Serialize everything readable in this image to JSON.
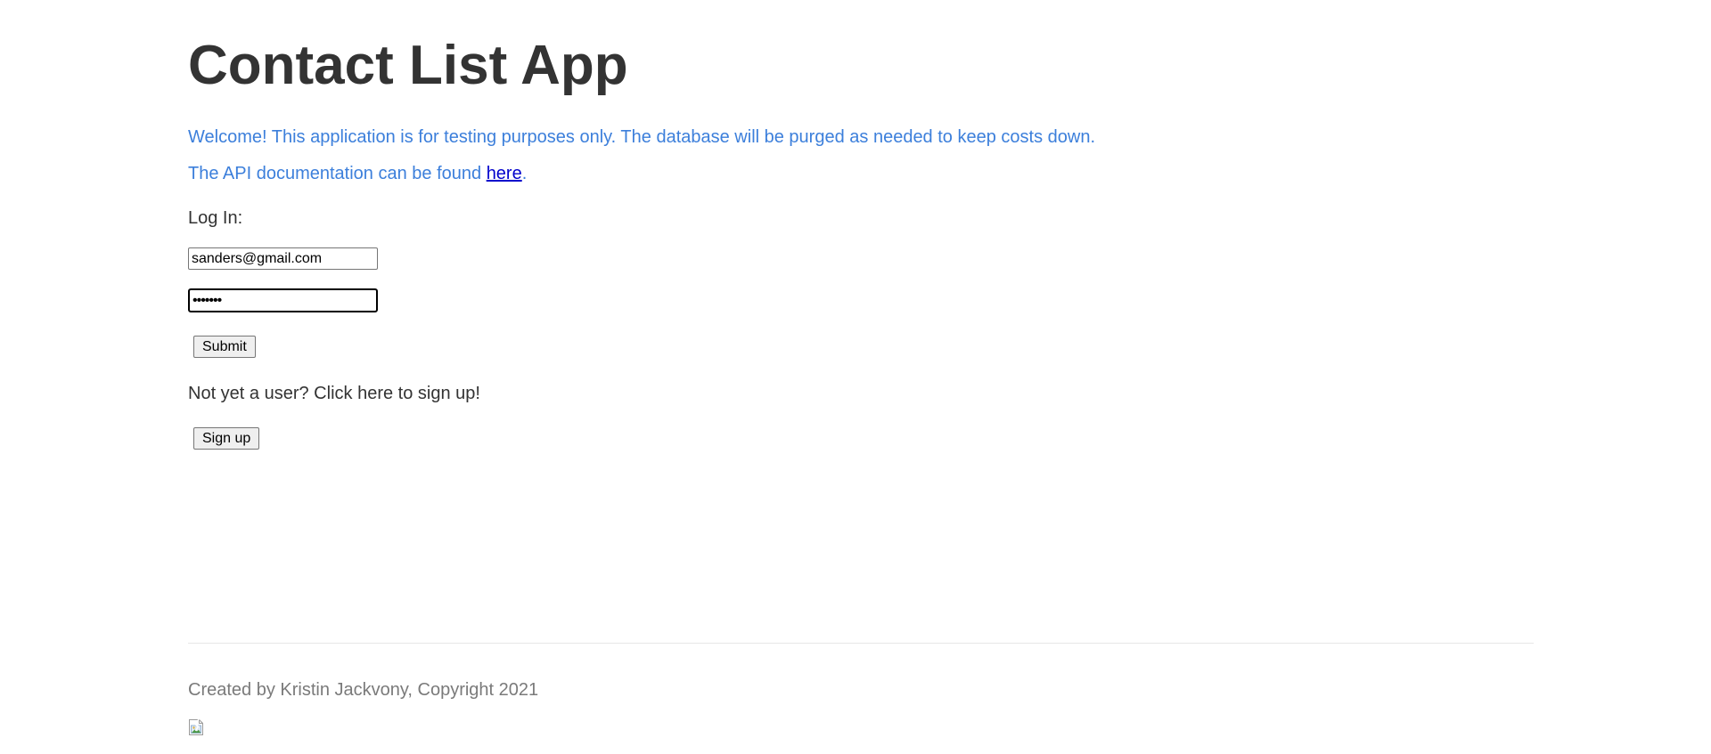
{
  "header": {
    "title": "Contact List App"
  },
  "intro": {
    "welcome": "Welcome! This application is for testing purposes only. The database will be purged as needed to keep costs down.",
    "api_prefix": "The API documentation can be found ",
    "api_link": "here",
    "api_suffix": "."
  },
  "login": {
    "label": "Log In:",
    "email_value": "sanders@gmail.com",
    "password_value": "•••••••",
    "submit_label": "Submit"
  },
  "signup": {
    "prompt": "Not yet a user? Click here to sign up!",
    "button_label": "Sign up"
  },
  "footer": {
    "text": "Created by Kristin Jackvony, Copyright 2021",
    "image_icon": "broken-image-icon"
  },
  "colors": {
    "title": "#333333",
    "notice": "#3c7fdb",
    "link": "#0000cc",
    "footer": "#7a7a7a"
  }
}
